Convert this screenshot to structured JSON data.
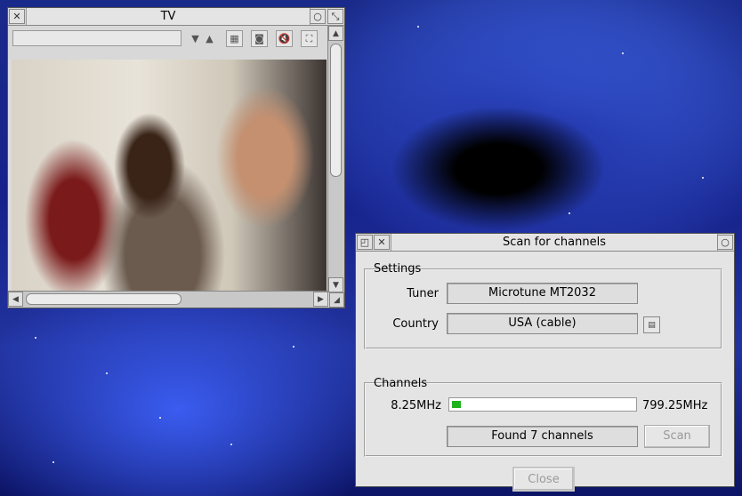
{
  "tv_window": {
    "title": "TV",
    "toolbar": {
      "channel_input": "",
      "icons": [
        "channel-down-icon",
        "channel-up-icon",
        "teletext-icon",
        "snapshot-icon",
        "mute-icon",
        "fullscreen-icon"
      ]
    }
  },
  "scan_window": {
    "title": "Scan for channels",
    "settings": {
      "group_label": "Settings",
      "tuner_label": "Tuner",
      "tuner_value": "Microtune MT2032",
      "country_label": "Country",
      "country_value": "USA (cable)"
    },
    "channels": {
      "group_label": "Channels",
      "freq_start": "8.25MHz",
      "freq_end": "799.25MHz",
      "progress": 0.05,
      "status": "Found 7 channels",
      "scan_button": "Scan"
    },
    "close_button": "Close"
  },
  "colors": {
    "progress_fill": "#1fb21f",
    "window_bg": "#dcdcdc",
    "disabled_text": "#9a9a9a"
  }
}
